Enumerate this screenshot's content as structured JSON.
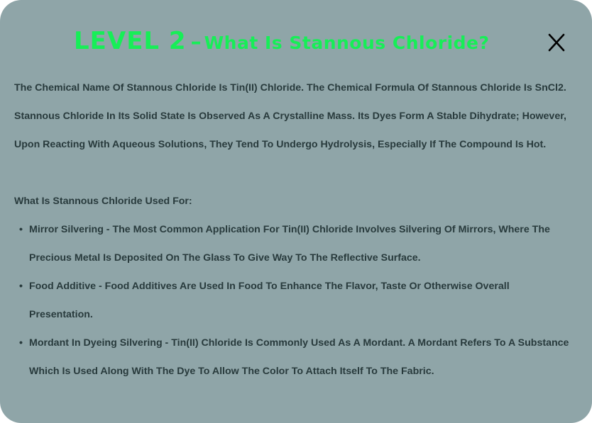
{
  "modal": {
    "title_level": "LEVEL 2",
    "title_separator": "–",
    "title_question": "What Is Stannous Chloride?",
    "close_icon": "close-icon",
    "intro": "The Chemical Name Of Stannous Chloride Is Tin(II) Chloride. The Chemical Formula Of Stannous Chloride Is SnCl2. Stannous Chloride In Its Solid State Is Observed As A Crystalline Mass. Its Dyes Form A Stable Dihydrate; However, Upon Reacting With Aqueous Solutions, They Tend To Undergo Hydrolysis, Especially If The Compound Is Hot.",
    "uses_heading": "What Is Stannous Chloride Used For:",
    "uses": [
      "Mirror Silvering - The Most Common Application For Tin(II) Chloride Involves Silvering Of Mirrors, Where The Precious Metal Is Deposited On The Glass To Give Way To The Reflective Surface.",
      "Food Additive - Food Additives Are Used In Food To Enhance The Flavor, Taste Or Otherwise Overall Presentation.",
      "Mordant In Dyeing Silvering - Tin(II) Chloride Is Commonly Used As A Mordant. A Mordant Refers To A Substance Which Is Used Along With The Dye To Allow The Color To Attach Itself To The Fabric."
    ]
  },
  "colors": {
    "panel_background": "#8fa5a8",
    "title_green": "#17ee57",
    "body_text": "#283a3c",
    "close_icon": "#000000"
  }
}
